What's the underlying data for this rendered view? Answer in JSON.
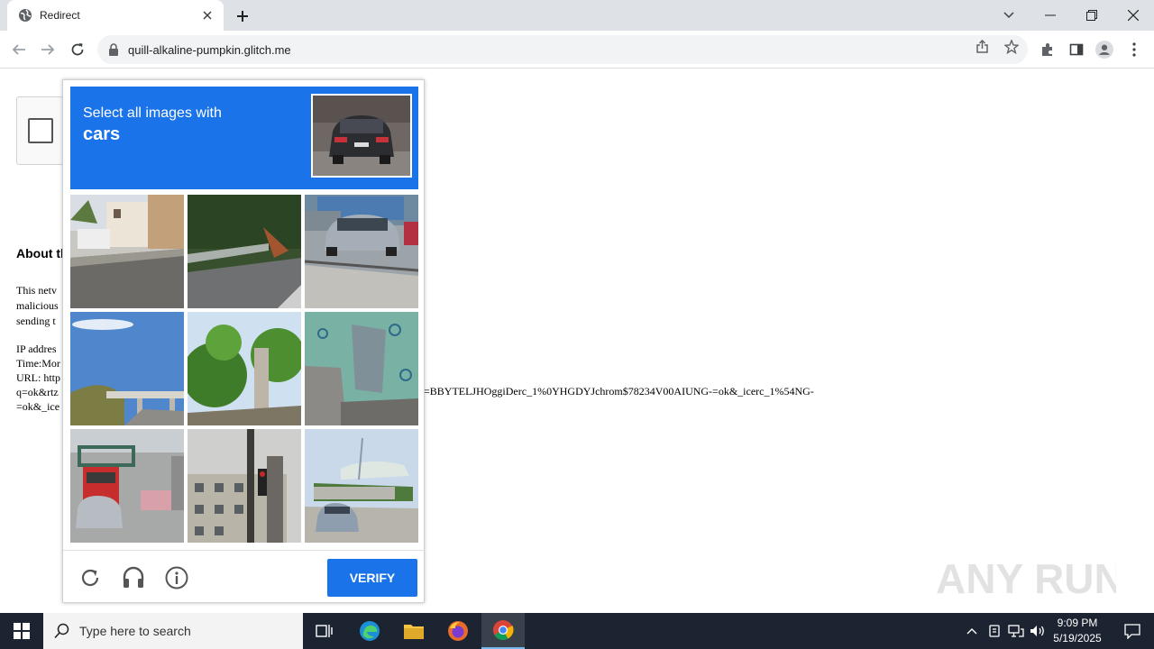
{
  "browser": {
    "tab_title": "Redirect",
    "url": "quill-alkaline-pumpkin.glitch.me"
  },
  "page": {
    "about_title": "About th",
    "about_text": [
      "This netv",
      "malicious",
      "sending t"
    ],
    "info_lines": [
      "IP addres",
      "Time:Mor",
      "URL: http",
      "q=ok&rtz",
      "=ok&_ice"
    ],
    "url_tail": "=BBYTELJHOggiDerc_1%0YHGDYJchrom$78234V00AIUNG-=ok&_icerc_1%54NG-"
  },
  "captcha": {
    "instruction": "Select all images with",
    "target": "cars",
    "verify_label": "VERIFY",
    "tiles": [
      {
        "name": "tile-houses-wall"
      },
      {
        "name": "tile-road-guardrail"
      },
      {
        "name": "tile-street-cars"
      },
      {
        "name": "tile-sky-bridge"
      },
      {
        "name": "tile-trees-house"
      },
      {
        "name": "tile-mural-wall"
      },
      {
        "name": "tile-bridge-bus-cars"
      },
      {
        "name": "tile-building-traffic-light"
      },
      {
        "name": "tile-roundabout-car"
      }
    ]
  },
  "watermark": {
    "text": "ANY RUN"
  },
  "taskbar": {
    "search_placeholder": "Type here to search",
    "time": "9:09 PM",
    "date": "5/19/2025"
  },
  "colors": {
    "accent": "#1a73e8",
    "taskbar": "#1c2431",
    "tabstrip": "#dee1e6"
  }
}
